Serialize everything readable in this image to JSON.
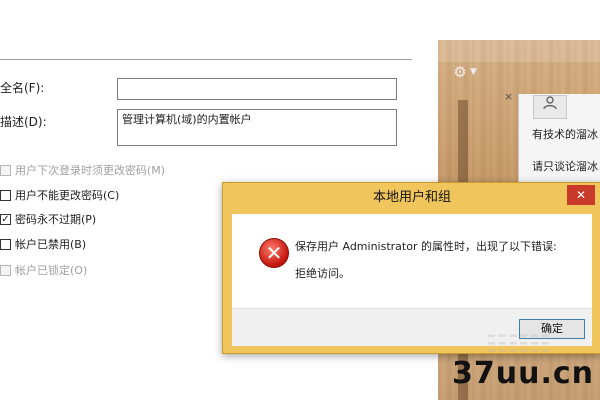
{
  "properties": {
    "full_name_label": "全名(F):",
    "full_name_value": "",
    "description_label": "描述(D):",
    "description_value": "管理计算机(域)的内置帐户",
    "checkboxes": [
      {
        "label": "用户下次登录时须更改密码(M)",
        "checked": false,
        "disabled": true
      },
      {
        "label": "用户不能更改密码(C)",
        "checked": false,
        "disabled": false
      },
      {
        "label": "密码永不过期(P)",
        "checked": true,
        "disabled": false
      },
      {
        "label": "帐户已禁用(B)",
        "checked": false,
        "disabled": false
      },
      {
        "label": "帐户已锁定(O)",
        "checked": false,
        "disabled": true
      }
    ]
  },
  "background_window": {
    "popup_items": [
      "有技术的溜冰",
      "请只谈论溜冰"
    ],
    "close_glyph": "×"
  },
  "dialog": {
    "title": "本地用户和组",
    "message": "保存用户 Administrator 的属性时，出现了以下错误:",
    "detail": "拒绝访问。",
    "ok_label": "确定",
    "close_glyph": "✕"
  },
  "watermark": {
    "text": "37uu.cn"
  },
  "icons": {
    "error": "error-icon",
    "gear": "gear-icon",
    "person": "person-icon"
  }
}
